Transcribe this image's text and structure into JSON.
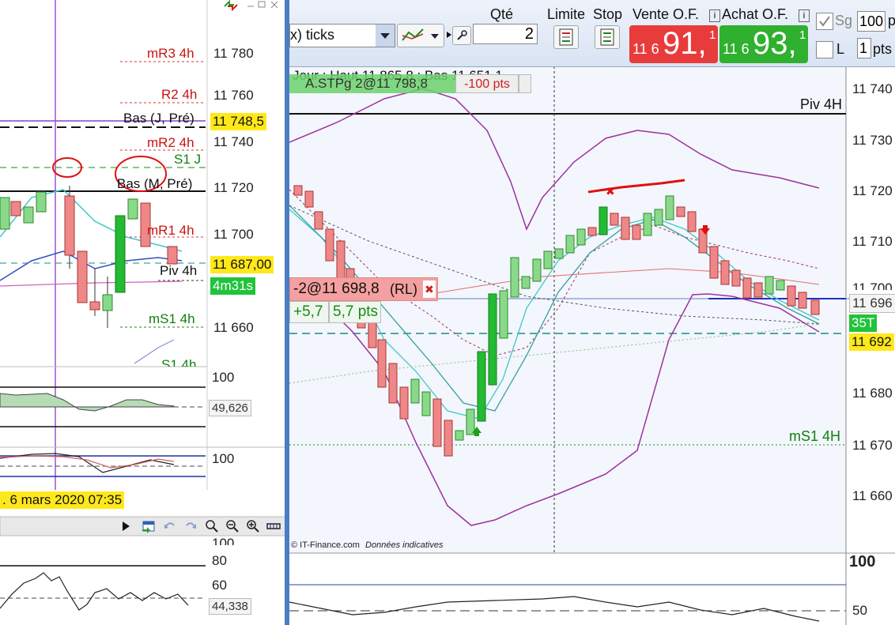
{
  "left_chart": {
    "levels": {
      "mr3": "mR3 4h",
      "r2": "R2 4h",
      "bas_j_pre": "Bas (J, Pré)",
      "mr2": "mR2 4h",
      "s1j": "S1 J",
      "bas_m_pre": "Bas (M, Pré)",
      "mr1": "mR1 4h",
      "piv": "Piv 4h",
      "ms1": "mS1 4h",
      "s1_partial": "S1 4h"
    },
    "prices": [
      "11 780",
      "11 760",
      "11 740",
      "11 720",
      "11 700",
      "11 660"
    ],
    "price_tag_yellow": "11 748,5",
    "current_price": "11 687,00",
    "countdown": "4m31s",
    "osc1_max": "100",
    "osc1_value": "49,626",
    "osc2_max": "100",
    "date_label": ". 6 mars 2020 07:35",
    "panel3_labels": [
      "100",
      "80",
      "60"
    ],
    "panel3_value": "44,338",
    "colors": {
      "accent_yellow": "#ffe81a",
      "bull": "#22bb33",
      "bear": "#e06060"
    }
  },
  "toolbar": {
    "period_select": "x) ticks",
    "qty_label": "Qté",
    "qty_value": "2",
    "limit_label": "Limite",
    "stop_label": "Stop",
    "sell_label": "Vente O.F.",
    "buy_label": "Achat O.F.",
    "sell_prefix": "11 6",
    "sell_big": "91,",
    "sell_sup": "1",
    "buy_prefix": "11 6",
    "buy_big": "93,",
    "buy_sup": "1",
    "sg_label": "Sg",
    "sg_value": "100",
    "sg_unit": "p",
    "l_label": "L",
    "l_value": "1",
    "l_unit": "pts",
    "sell_color": "#e83b3b",
    "buy_color": "#2fb02f"
  },
  "right_chart": {
    "info_line": "Jour : Haut 11 865,8 ; Bas 11 651,1",
    "stop_order": "A.STPg 2@11 798,8",
    "stop_pts": "-100 pts",
    "piv_label": "Piv 4H",
    "ms1_label": "mS1 4H",
    "position": "-2@11 698,8",
    "position_rl": "(RL)",
    "pnl_value": "+5,7",
    "pnl_pts": "5,7 pts",
    "prices": [
      "11 740",
      "11 730",
      "11 720",
      "11 710",
      "11 700",
      "11 680",
      "11 670",
      "11 660"
    ],
    "current_price": "11 696",
    "countdown": "35T",
    "level_price": "11 692",
    "source": "© IT-Finance.com",
    "source_note": "Données indicatives",
    "osc_labels": [
      "100",
      "50"
    ]
  }
}
